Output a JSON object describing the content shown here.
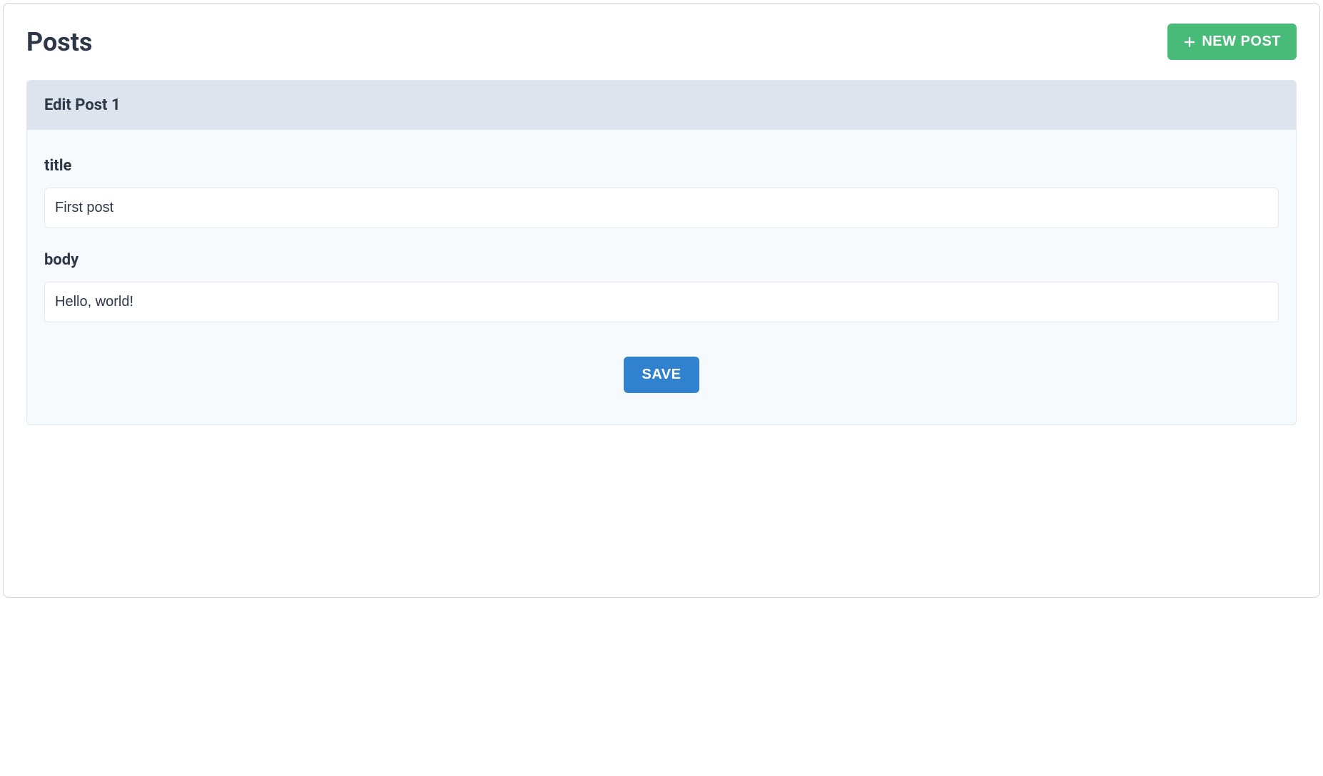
{
  "header": {
    "title": "Posts",
    "new_post_label": "NEW POST"
  },
  "card": {
    "title": "Edit Post 1",
    "form": {
      "title_label": "title",
      "title_value": "First post",
      "body_label": "body",
      "body_value": "Hello, world!",
      "save_label": "SAVE"
    }
  },
  "colors": {
    "primary_green": "#48bb78",
    "primary_blue": "#3182ce",
    "card_header_bg": "#dde4ee",
    "card_bg": "#f7fafc",
    "border": "#e2e8f0",
    "text": "#2d3748"
  }
}
